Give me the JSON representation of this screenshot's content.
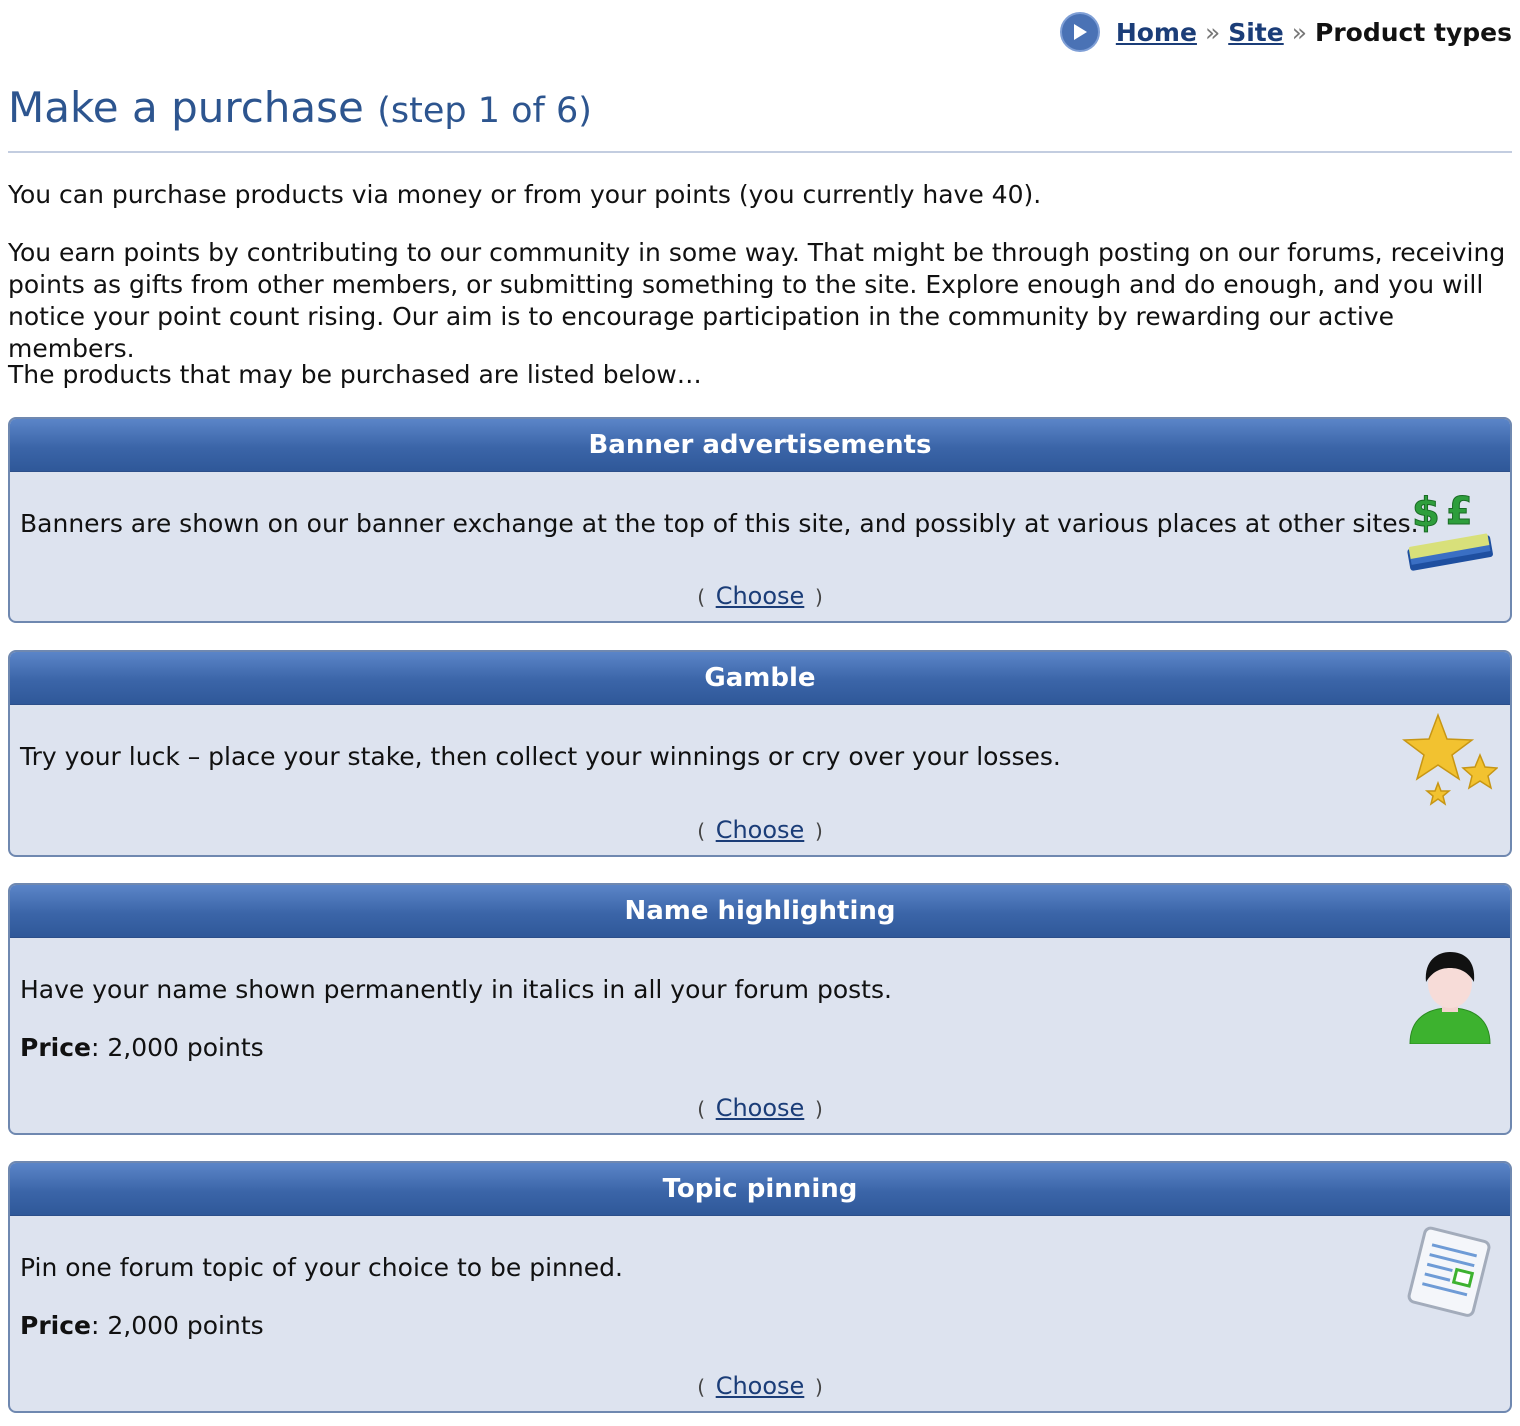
{
  "breadcrumb": {
    "home": "Home",
    "site": "Site",
    "separator": "»",
    "current": "Product types"
  },
  "page": {
    "title": "Make a purchase",
    "step": "(step 1 of 6)"
  },
  "intro": {
    "para1": "You can purchase products via money or from your points (you currently have 40).",
    "para2": "You earn points by contributing to our community in some way. That might be through posting on our forums, receiving points as gifts from other members, or submitting something to the site. Explore enough and do enough, and you will notice your point count rising. Our aim is to encourage participation in the community by rewarding our active members.",
    "para3": "The products that may be purchased are listed below…"
  },
  "products": [
    {
      "title": "Banner advertisements",
      "description": "Banners are shown on our banner exchange at the top of this site, and possibly at various places at other sites.",
      "choose": "Choose",
      "icon": "money-banner-icon"
    },
    {
      "title": "Gamble",
      "description": "Try your luck – place your stake, then collect your winnings or cry over your losses.",
      "choose": "Choose",
      "icon": "stars-icon"
    },
    {
      "title": "Name highlighting",
      "description": "Have your name shown permanently in italics in all your forum posts.",
      "price_label": "Price",
      "price_value": ": 2,000 points",
      "choose": "Choose",
      "icon": "user-avatar-icon"
    },
    {
      "title": "Topic pinning",
      "description": "Pin one forum topic of your choice to be pinned.",
      "price_label": "Price",
      "price_value": ": 2,000 points",
      "choose": "Choose",
      "icon": "document-icon"
    }
  ],
  "labels": {
    "paren_open": "(",
    "paren_close": ")"
  },
  "colors": {
    "accent": "#2d558f",
    "header_bar": "#3b65a8",
    "card_bg": "#dde3ef",
    "link": "#1b3d78"
  }
}
